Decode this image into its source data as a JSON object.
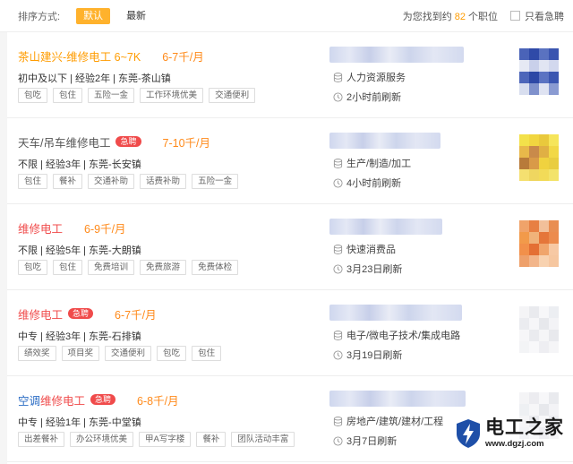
{
  "sort": {
    "label": "排序方式:",
    "options": [
      {
        "label": "默认",
        "active": true
      },
      {
        "label": "最新",
        "active": false
      }
    ]
  },
  "summary": {
    "prefix": "为您找到约",
    "count": "82",
    "suffix": "个职位",
    "urgent_only": "只看急聘"
  },
  "jobs": [
    {
      "title_parts": [
        {
          "text": "茶山建兴-维修电工 6~7K",
          "color": "#ff9c00"
        }
      ],
      "urgent": "",
      "salary": "6-7千/月",
      "meta": "初中及以下 | 经验2年 | 东莞-茶山镇",
      "tags": [
        "包吃",
        "包住",
        "五险一金",
        "工作环境优美",
        "交通便利"
      ],
      "industry": "人力资源服务",
      "refresh": "2小时前刷新"
    },
    {
      "title_parts": [
        {
          "text": "天车/吊车维修电工",
          "color": "#555555"
        }
      ],
      "urgent": "急聘",
      "salary": "7-10千/月",
      "meta": "不限 | 经验3年 | 东莞-长安镇",
      "tags": [
        "包住",
        "餐补",
        "交通补助",
        "话费补助",
        "五险一金"
      ],
      "industry": "生产/制造/加工",
      "refresh": "4小时前刷新"
    },
    {
      "title_parts": [
        {
          "text": "维修电工",
          "color": "#f04b4b"
        }
      ],
      "urgent": "",
      "salary": "6-9千/月",
      "meta": "不限 | 经验5年 | 东莞-大朗镇",
      "tags": [
        "包吃",
        "包住",
        "免费培训",
        "免费旅游",
        "免费体检"
      ],
      "industry": "快速消费品",
      "refresh": "3月23日刷新"
    },
    {
      "title_parts": [
        {
          "text": "维修电工",
          "color": "#f04b4b"
        }
      ],
      "urgent": "急聘",
      "salary": "6-7千/月",
      "meta": "中专 | 经验3年 | 东莞-石排镇",
      "tags": [
        "绩效奖",
        "项目奖",
        "交通便利",
        "包吃",
        "包住"
      ],
      "industry": "电子/微电子技术/集成电路",
      "refresh": "3月19日刷新"
    },
    {
      "title_parts": [
        {
          "text": "空调",
          "color": "#2b6cc4"
        },
        {
          "text": "维修电工",
          "color": "#f04b4b"
        }
      ],
      "urgent": "急聘",
      "salary": "6-8千/月",
      "meta": "中专 | 经验1年 | 东莞-中堂镇",
      "tags": [
        "出差餐补",
        "办公环境优美",
        "甲A写字楼",
        "餐补",
        "团队活动丰富"
      ],
      "industry": "房地产/建筑/建材/工程",
      "refresh": "3月7日刷新"
    }
  ],
  "watermark": {
    "title": "电工之家",
    "url": "www.dgzj.com"
  },
  "colors": {
    "accent": "#ffb22c",
    "salary": "#ff8a1a",
    "urgent": "#f04b4b"
  },
  "icons": {
    "industry": "database-icon",
    "refresh": "clock-icon",
    "watermark": "lightning-shield-icon"
  }
}
